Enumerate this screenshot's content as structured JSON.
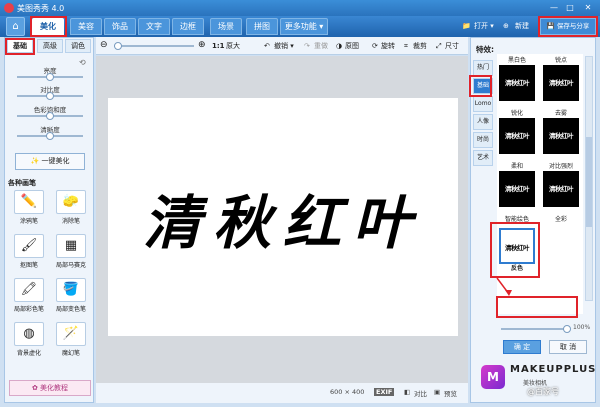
{
  "app": {
    "title": "美图秀秀 4.0",
    "window_buttons": [
      "—",
      "□",
      "✕"
    ]
  },
  "toolbar": {
    "home_icon": "house-icon",
    "tabs": [
      {
        "label": "美化",
        "active": true
      },
      {
        "label": "美容",
        "active": false
      },
      {
        "label": "饰品",
        "active": false
      },
      {
        "label": "文字",
        "active": false
      },
      {
        "label": "边框",
        "active": false
      },
      {
        "label": "场景",
        "active": false
      },
      {
        "label": "拼图",
        "active": false
      },
      {
        "label": "更多功能 ▾",
        "active": false
      }
    ],
    "open_label": "打开 ▾",
    "new_label": "新建",
    "save_label": "保存与分享"
  },
  "left_panel": {
    "subtabs": [
      "基础",
      "高级",
      "调色"
    ],
    "sliders": [
      {
        "label": "亮度",
        "level": 0.5
      },
      {
        "label": "对比度",
        "level": 0.5
      },
      {
        "label": "色彩饱和度",
        "level": 0.5
      },
      {
        "label": "清晰度",
        "level": 0.5
      }
    ],
    "one_key_label": "一键美化",
    "brushes_title": "各种画笔",
    "brushes": [
      "涂鸦笔",
      "消除笔",
      "抠图笔",
      "局部马赛克",
      "局部彩色笔",
      "局部变色笔",
      "背景虚化",
      "魔幻笔"
    ],
    "tutorial_label": "美化教程"
  },
  "canvas_toolbar": {
    "ratio_label": "1:1",
    "original_size_label": "原大",
    "undo_label": "撤销 ▾",
    "redo_label": "重做",
    "compare_label": "原图",
    "rotate_label": "旋转",
    "crop_label": "裁剪",
    "resize_label": "尺寸"
  },
  "canvas": {
    "text": "清秋红叶",
    "background": "#ffffff"
  },
  "status_bar": {
    "dimensions": "600 × 400",
    "exif_label": "EXIF",
    "compare_label": "对比",
    "preview_label": "预览"
  },
  "right_panel": {
    "title": "特效:",
    "categories": [
      "热门",
      "基础",
      "Lomo",
      "人像",
      "时尚",
      "艺术"
    ],
    "active_category": "基础",
    "effects": [
      {
        "name": "黑白色",
        "style": "dark"
      },
      {
        "name": "锐点",
        "style": "dark"
      },
      {
        "name": "锐化",
        "style": "dark"
      },
      {
        "name": "去雾",
        "style": "dark"
      },
      {
        "name": "柔和",
        "style": "dark"
      },
      {
        "name": "对比强烈",
        "style": "dark"
      },
      {
        "name": "智能绘色",
        "style": "dark"
      },
      {
        "name": "全彩",
        "style": "dark"
      },
      {
        "name": "反色",
        "style": "light",
        "selected": true
      }
    ],
    "thumb_text": "清秋红叶",
    "opacity": "100%",
    "ok_label": "确 定",
    "cancel_label": "取 消"
  },
  "brand": {
    "name": "MAKEUPPLUS",
    "sub": "美妆相机",
    "watermark": "@百家号"
  },
  "colors": {
    "accent": "#2f7cd0",
    "highlight": "#e0232a"
  }
}
